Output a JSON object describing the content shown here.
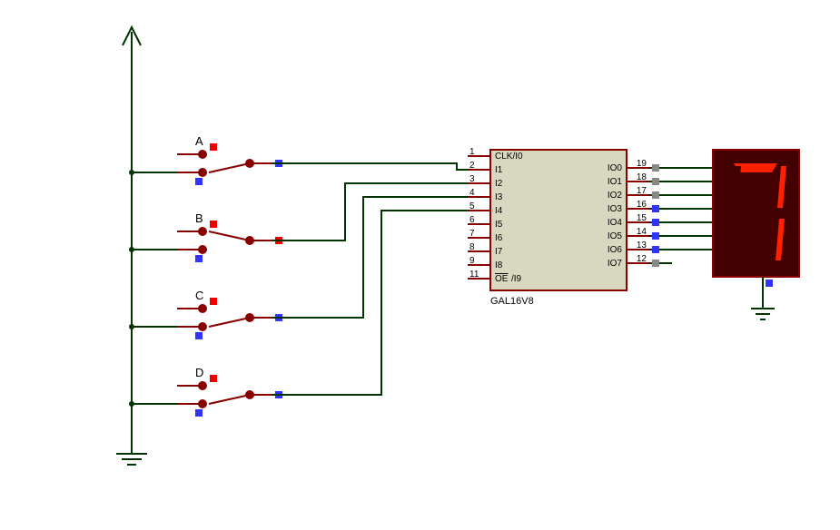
{
  "switches": [
    {
      "name": "A",
      "state": "open"
    },
    {
      "name": "B",
      "state": "closed"
    },
    {
      "name": "C",
      "state": "open"
    },
    {
      "name": "D",
      "state": "open"
    }
  ],
  "chip": {
    "ref": "GAL16V8",
    "left_pins": [
      {
        "num": "1",
        "name": "CLK/I0"
      },
      {
        "num": "2",
        "name": "I1"
      },
      {
        "num": "3",
        "name": "I2"
      },
      {
        "num": "4",
        "name": "I3"
      },
      {
        "num": "5",
        "name": "I4"
      },
      {
        "num": "6",
        "name": "I5"
      },
      {
        "num": "7",
        "name": "I6"
      },
      {
        "num": "8",
        "name": "I7"
      },
      {
        "num": "9",
        "name": "I8"
      },
      {
        "num": "11",
        "name": "OE/I9",
        "overline": true
      }
    ],
    "right_pins": [
      {
        "num": "19",
        "name": "IO0"
      },
      {
        "num": "18",
        "name": "IO1"
      },
      {
        "num": "17",
        "name": "IO2"
      },
      {
        "num": "16",
        "name": "IO3"
      },
      {
        "num": "15",
        "name": "IO4"
      },
      {
        "num": "14",
        "name": "IO5"
      },
      {
        "num": "13",
        "name": "IO6"
      },
      {
        "num": "12",
        "name": "IO7"
      }
    ]
  },
  "display": {
    "digit": "7",
    "segments": {
      "a": true,
      "b": true,
      "c": true,
      "d": false,
      "e": false,
      "f": false,
      "g": false
    }
  },
  "chart_data": {
    "type": "schematic",
    "description": "Four SPDT switches A–D feed inputs I1–I4 of a GAL16V8 programmable logic device whose outputs IO0–IO6 drive a common-cathode 7-segment display showing the decoded hex value. Switch B is shown toggled to the alternate position; with the pictured inputs the display reads 7.",
    "inputs": {
      "A": 0,
      "B": 1,
      "C": 0,
      "D": 0
    },
    "output_digit": 7
  }
}
